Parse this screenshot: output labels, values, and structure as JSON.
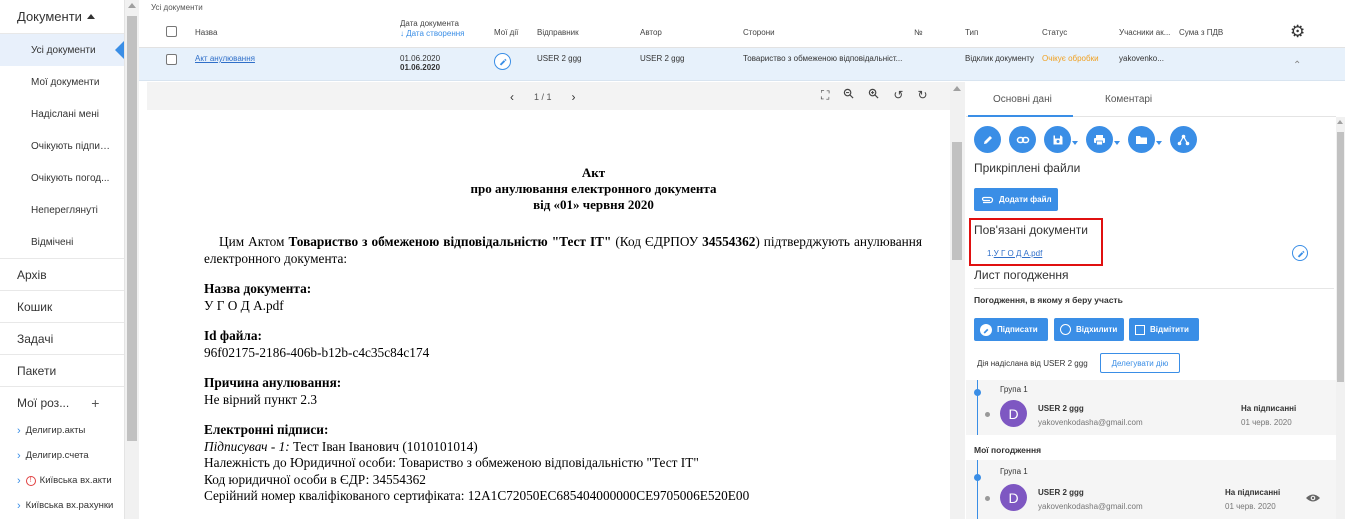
{
  "sidebar": {
    "documents_header": "Документи",
    "sub_items": [
      {
        "label": "Усі документи"
      },
      {
        "label": "Мої документи"
      },
      {
        "label": "Надіслані мені"
      },
      {
        "label": "Очікують підпис..."
      },
      {
        "label": "Очікують погод..."
      },
      {
        "label": "Непереглянуті"
      },
      {
        "label": "Відмічені"
      }
    ],
    "main_items": [
      {
        "label": "Архів"
      },
      {
        "label": "Кошик"
      },
      {
        "label": "Задачі"
      },
      {
        "label": "Пакети"
      },
      {
        "label": "Мої роз...",
        "plus": "+"
      }
    ],
    "folders": [
      {
        "label": "Делигир.акты"
      },
      {
        "label": "Делигир.счета"
      },
      {
        "label": "Київська вх.акти"
      },
      {
        "label": "Київська вх.рахунки"
      }
    ]
  },
  "list": {
    "breadcrumb": "Усі документи",
    "headers": {
      "name": "Назва",
      "doc_date": "Дата документа",
      "created_date": "↓ Дата створення",
      "my_actions": "Мої дії",
      "sender": "Відправник",
      "author": "Автор",
      "parties": "Сторони",
      "number": "№",
      "type": "Тип",
      "status": "Статус",
      "participants": "Учасники ак...",
      "vat_sum": "Сума з ПДВ"
    },
    "row": {
      "name": "Акт анулювання",
      "doc_date": "01.06.2020",
      "created_date": "01.06.2020",
      "sender": "USER 2 ggg",
      "author": "USER 2 ggg",
      "parties": "Товариство з обмеженою відповідальніст...",
      "type": "Відклик документу",
      "status": "Очікує обробки",
      "participants": "yakovenko..."
    }
  },
  "viewer": {
    "page_indicator": "1 / 1",
    "doc": {
      "title_lines": [
        "Акт",
        "про анулювання електронного документа",
        "від «01» червня 2020"
      ],
      "intro_pre": "Цим Актом ",
      "intro_company": "Товариство з обмеженою відповідальністю \"Тест ІТ\"",
      "intro_code_pre": " (Код ЄДРПОУ ",
      "intro_code": "34554362",
      "intro_post": ") підтверджують анулювання електронного документа:",
      "doc_name_label": "Назва документа:",
      "doc_name_value": "У Г О Д А.pdf",
      "file_id_label": "Id файла:",
      "file_id_value": "96f02175-2186-406b-b12b-c4c35c84c174",
      "reason_label": "Причина анулювання:",
      "reason_value": "Не вірний пункт 2.3",
      "signatures_label": "Електронні підписи:",
      "signer_label": "Підписувач - 1:",
      "signer_value": " Тест Іван Іванович (1010101014)",
      "belongs": "Належність до Юридичної особи: Товариство з обмеженою відповідальністю \"Тест ІТ\"",
      "legal_code": "Код юридичної особи в ЄДР: 34554362",
      "cert_serial": "Серійний номер кваліфікованого сертифіката: 12A1C72050EC685404000000CE9705006E520E00"
    }
  },
  "panel": {
    "tabs": [
      "Основні дані",
      "Коментарі"
    ],
    "attached_files_title": "Прикріплені файли",
    "add_file_label": "Додати файл",
    "related_docs_title": "Пов'язані документи",
    "related_doc_prefix": "1.",
    "related_doc_link": "У Г О Д А.pdf",
    "approval_sheet_title": "Лист погодження",
    "my_participation_title": "Погодження, в якому я беру участь",
    "sign_label": "Підписати",
    "reject_label": "Відхилити",
    "mark_label": "Відмітити",
    "action_sent_by": "Дія надіслана від USER 2 ggg",
    "delegate_label": "Делегувати дію",
    "group_label": "Група 1",
    "user_name": "USER 2 ggg",
    "user_email": "yakovenkodasha@gmail.com",
    "user_initial": "D",
    "signing_status": "На підписанні",
    "signing_date": "01 черв. 2020",
    "my_approvals_title": "Мої погодження",
    "accent_color": "#3a8ee6"
  }
}
